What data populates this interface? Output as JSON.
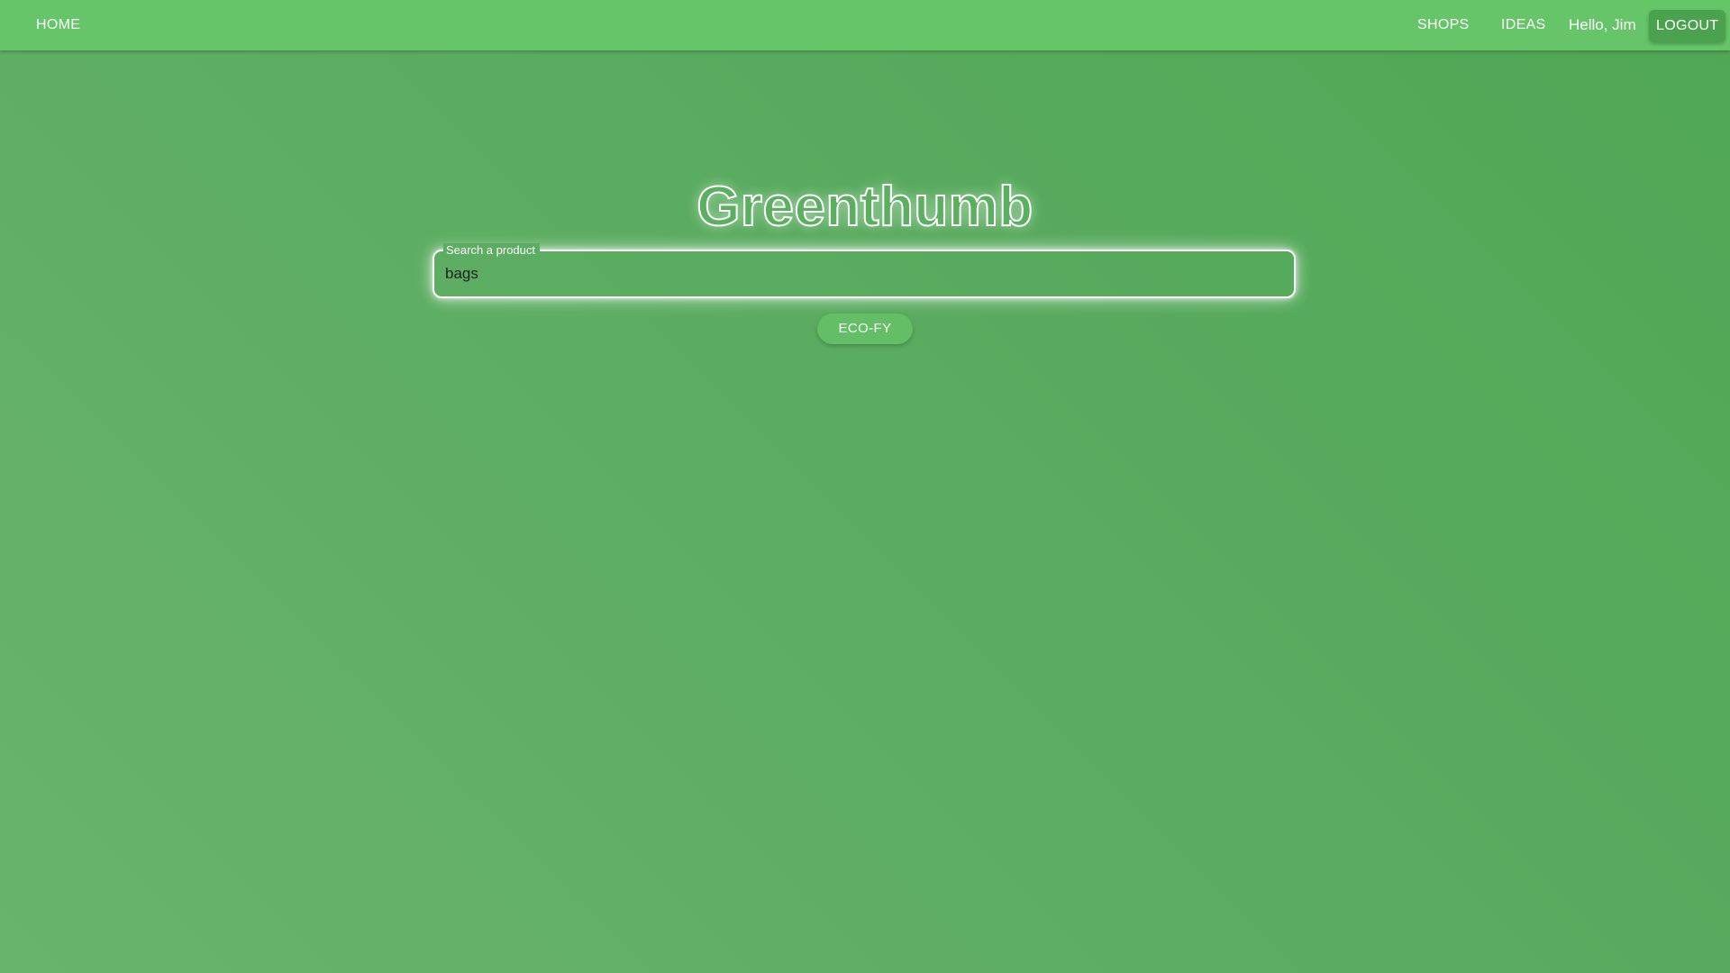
{
  "nav": {
    "home_label": "HOME",
    "shops_label": "SHOPS",
    "ideas_label": "IDEAS",
    "greeting": "Hello, Jim",
    "logout_label": "LOGOUT"
  },
  "hero": {
    "title": "Greenthumb"
  },
  "search": {
    "label": "Search a product",
    "value": "bags"
  },
  "actions": {
    "ecofy_label": "ECO-FY"
  },
  "colors": {
    "navbar": "#66c569",
    "background": "#5cad62",
    "logout_button": "#4aa14e",
    "ecofy_button": "#63be66",
    "text": "#ffffff"
  }
}
